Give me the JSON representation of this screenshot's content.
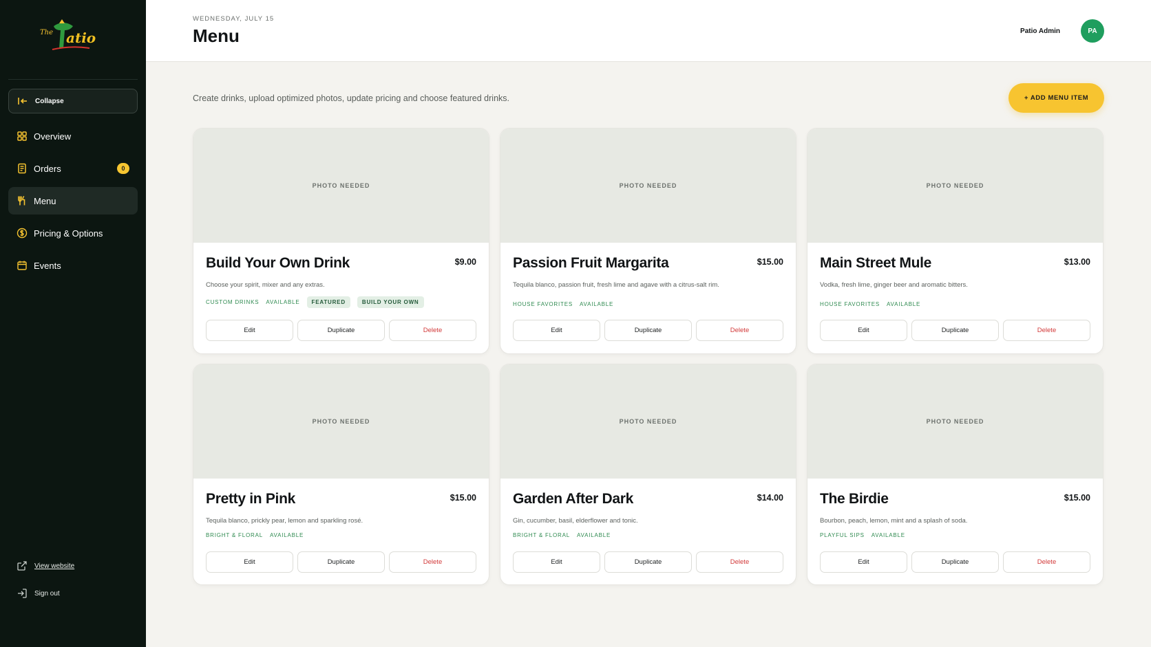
{
  "brand": {
    "logo_name": "The Patio"
  },
  "sidebar": {
    "collapse_label": "Collapse",
    "items": [
      {
        "label": "Overview",
        "icon": "grid-icon"
      },
      {
        "label": "Orders",
        "icon": "receipt-icon",
        "badge": "0"
      },
      {
        "label": "Menu",
        "icon": "utensils-icon"
      },
      {
        "label": "Pricing & Options",
        "icon": "dollar-icon"
      },
      {
        "label": "Events",
        "icon": "calendar-icon"
      }
    ],
    "view_website": "View website",
    "sign_out": "Sign out"
  },
  "header": {
    "date": "WEDNESDAY, JULY 15",
    "title": "Menu",
    "user_name": "Patio Admin",
    "avatar_initials": "PA"
  },
  "main": {
    "subtitle": "Create drinks, upload optimized photos, update pricing and choose featured drinks.",
    "add_button": "+ ADD MENU ITEM",
    "photo_placeholder": "PHOTO NEEDED",
    "actions": {
      "edit": "Edit",
      "duplicate": "Duplicate",
      "delete": "Delete"
    },
    "items": [
      {
        "name": "Build Your Own Drink",
        "price": "$9.00",
        "description": "Choose your spirit, mixer and any extras.",
        "category": "CUSTOM DRINKS",
        "status": "AVAILABLE",
        "pills": [
          "FEATURED",
          "BUILD YOUR OWN"
        ]
      },
      {
        "name": "Passion Fruit Margarita",
        "price": "$15.00",
        "description": "Tequila blanco, passion fruit, fresh lime and agave with a citrus-salt rim.",
        "category": "HOUSE FAVORITES",
        "status": "AVAILABLE"
      },
      {
        "name": "Main Street Mule",
        "price": "$13.00",
        "description": "Vodka, fresh lime, ginger beer and aromatic bitters.",
        "category": "HOUSE FAVORITES",
        "status": "AVAILABLE"
      },
      {
        "name": "Pretty in Pink",
        "price": "$15.00",
        "description": "Tequila blanco, prickly pear, lemon and sparkling rosé.",
        "category": "BRIGHT & FLORAL",
        "status": "AVAILABLE"
      },
      {
        "name": "Garden After Dark",
        "price": "$14.00",
        "description": "Gin, cucumber, basil, elderflower and tonic.",
        "category": "BRIGHT & FLORAL",
        "status": "AVAILABLE"
      },
      {
        "name": "The Birdie",
        "price": "$15.00",
        "description": "Bourbon, peach, lemon, mint and a splash of soda.",
        "category": "PLAYFUL SIPS",
        "status": "AVAILABLE"
      }
    ]
  },
  "colors": {
    "sidebar_bg": "#0c1611",
    "accent_yellow": "#f7c430",
    "accent_green": "#1f9e5e",
    "delete_red": "#d23838",
    "tag_green": "#2f8a50"
  }
}
